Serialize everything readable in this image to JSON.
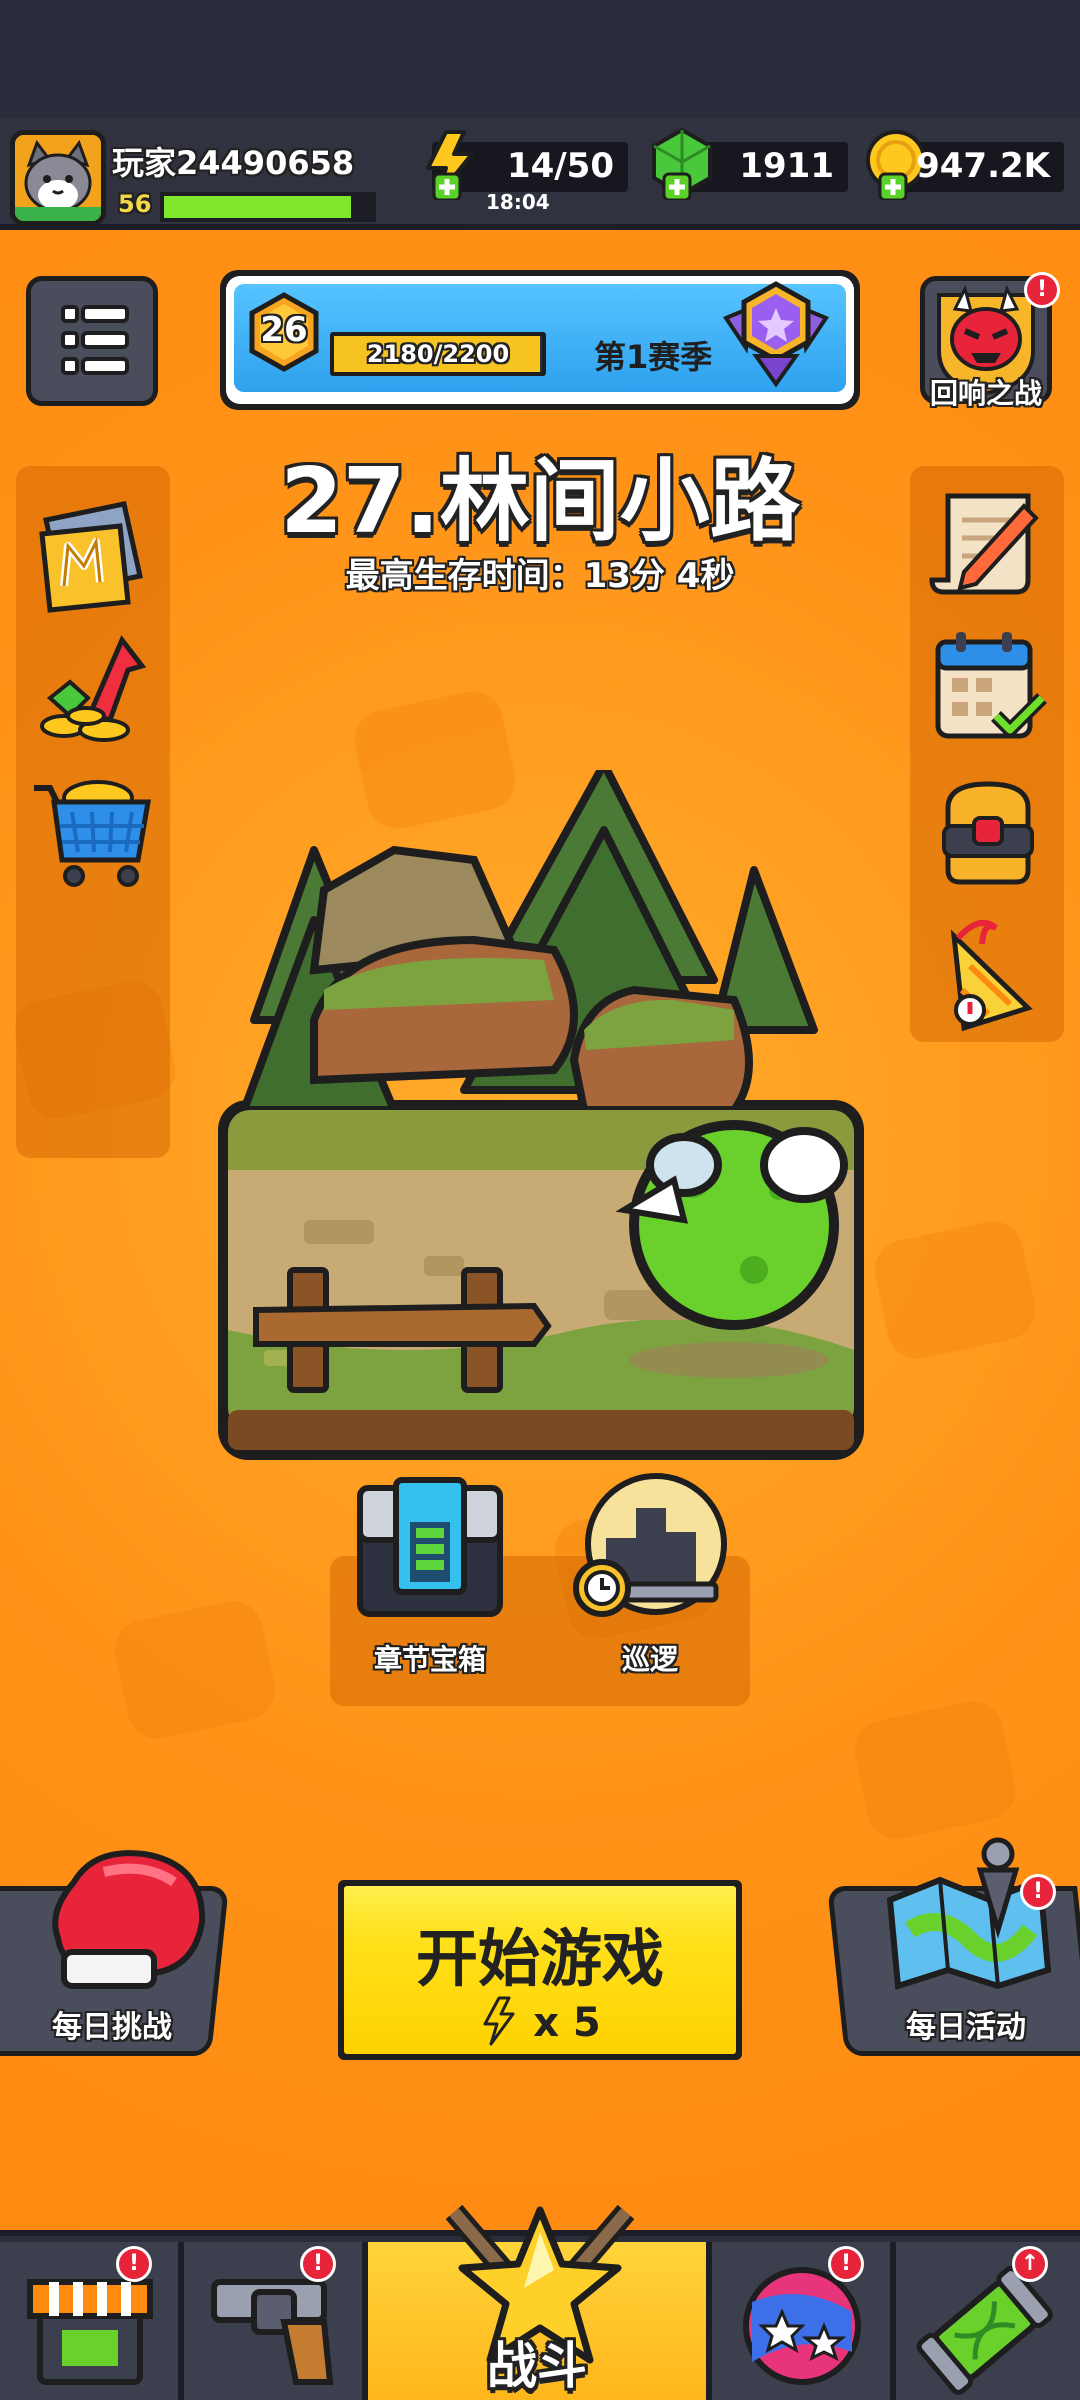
{
  "header": {
    "player_name": "玩家24490658",
    "player_level": "56",
    "xp_fraction": 0.9,
    "energy": "14/50",
    "energy_timer": "18:04",
    "gems": "1911",
    "coins": "947.2K"
  },
  "season": {
    "level": "26",
    "xp": "2180/2200",
    "xp_fraction": 0.99,
    "label": "第1赛季"
  },
  "echo_battle": {
    "label": "回响之战",
    "badge": "!"
  },
  "stage": {
    "title": "27.林间小路",
    "best_time": "最高生存时间：13分 4秒"
  },
  "chapter_chest": {
    "label": "章节宝箱"
  },
  "patrol": {
    "label": "巡逻"
  },
  "daily_challenge": {
    "label": "每日挑战"
  },
  "daily_event": {
    "label": "每日活动",
    "badge": "!"
  },
  "start_button": {
    "label": "开始游戏",
    "cost": "x 5"
  },
  "bottom_nav": {
    "battle_label": "战斗",
    "badge": "!",
    "upgrade_badge": "↑"
  },
  "colors": {
    "background_orange": "#ff9318",
    "accent_yellow": "#ffd200",
    "xp_green": "#7ee62b",
    "season_blue": "#2ea1ee",
    "badge_red": "#e8243b"
  }
}
